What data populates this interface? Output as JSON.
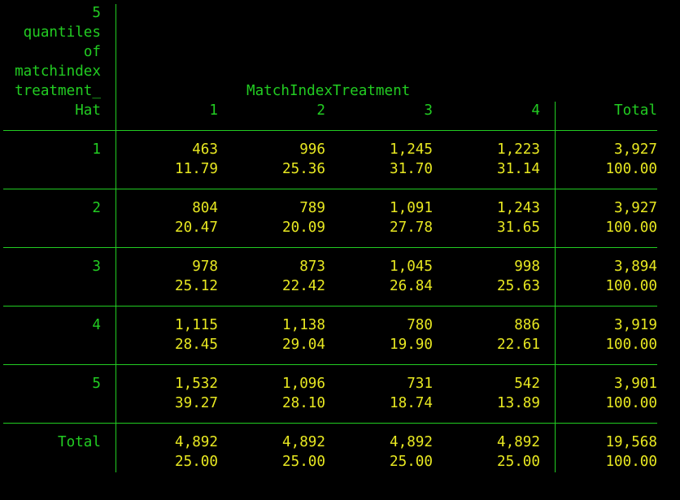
{
  "table": {
    "row_var_label": [
      "5",
      "quantiles",
      "of",
      "matchindex",
      "treatment_",
      "Hat"
    ],
    "col_var_label": "MatchIndexTreatment",
    "col_headers": [
      "1",
      "2",
      "3",
      "4"
    ],
    "total_label": "Total",
    "rows": [
      {
        "label": "1",
        "freq": [
          "463",
          "996",
          "1,245",
          "1,223"
        ],
        "freq_total": "3,927",
        "pct": [
          "11.79",
          "25.36",
          "31.70",
          "31.14"
        ],
        "pct_total": "100.00"
      },
      {
        "label": "2",
        "freq": [
          "804",
          "789",
          "1,091",
          "1,243"
        ],
        "freq_total": "3,927",
        "pct": [
          "20.47",
          "20.09",
          "27.78",
          "31.65"
        ],
        "pct_total": "100.00"
      },
      {
        "label": "3",
        "freq": [
          "978",
          "873",
          "1,045",
          "998"
        ],
        "freq_total": "3,894",
        "pct": [
          "25.12",
          "22.42",
          "26.84",
          "25.63"
        ],
        "pct_total": "100.00"
      },
      {
        "label": "4",
        "freq": [
          "1,115",
          "1,138",
          "780",
          "886"
        ],
        "freq_total": "3,919",
        "pct": [
          "28.45",
          "29.04",
          "19.90",
          "22.61"
        ],
        "pct_total": "100.00"
      },
      {
        "label": "5",
        "freq": [
          "1,532",
          "1,096",
          "731",
          "542"
        ],
        "freq_total": "3,901",
        "pct": [
          "39.27",
          "28.10",
          "18.74",
          "13.89"
        ],
        "pct_total": "100.00"
      },
      {
        "label": "Total",
        "freq": [
          "4,892",
          "4,892",
          "4,892",
          "4,892"
        ],
        "freq_total": "19,568",
        "pct": [
          "25.00",
          "25.00",
          "25.00",
          "25.00"
        ],
        "pct_total": "100.00"
      }
    ]
  },
  "colors": {
    "background": "#000000",
    "label_text": "#22cc22",
    "value_text": "#e8e821",
    "rules": "#22cc22"
  }
}
